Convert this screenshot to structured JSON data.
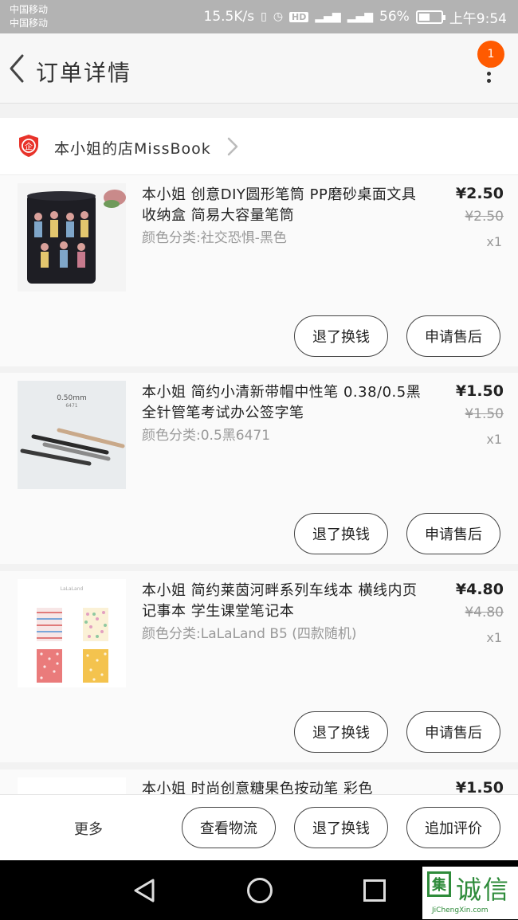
{
  "status_bar": {
    "carrier1": "中国移动",
    "carrier2": "中国移动",
    "speed": "15.5K/s",
    "hd": "HD",
    "battery": "56%",
    "battery_level": 0.56,
    "time": "上午9:54"
  },
  "header": {
    "title": "订单详情",
    "badge": "1"
  },
  "store": {
    "name": "本小姐的店MissBook",
    "badge_char": "企"
  },
  "items": [
    {
      "title": "本小姐 创意DIY圆形笔筒 PP磨砂桌面文具收纳盒 简易大容量笔筒",
      "variant": "颜色分类:社交恐惧-黑色",
      "price": "¥2.50",
      "orig_price": "¥2.50",
      "qty": "x1",
      "refund_label": "退了换钱",
      "aftersale_label": "申请售后"
    },
    {
      "title": "本小姐 简约小清新带帽中性笔 0.38/0.5黑全针管笔考试办公签字笔",
      "variant": "颜色分类:0.5黑6471",
      "price": "¥1.50",
      "orig_price": "¥1.50",
      "qty": "x1",
      "refund_label": "退了换钱",
      "aftersale_label": "申请售后",
      "thumb_text1": "0.50mm",
      "thumb_text2": "6471"
    },
    {
      "title": "本小姐 简约莱茵河畔系列车线本 横线内页记事本 学生课堂笔记本",
      "variant": "颜色分类:LaLaLand B5 (四款随机)",
      "price": "¥4.80",
      "orig_price": "¥4.80",
      "qty": "x1",
      "refund_label": "退了换钱",
      "aftersale_label": "申请售后",
      "thumb_text1": "LaLaLand"
    },
    {
      "title": "本小姐 时尚创意糖果色按动笔 彩色",
      "price": "¥1.50"
    }
  ],
  "bottom_bar": {
    "more": "更多",
    "logistics": "查看物流",
    "refund": "退了换钱",
    "review": "追加评价"
  },
  "watermark": {
    "mark": "集",
    "text": "诚信",
    "url": "JiChengXin.com"
  },
  "colors": {
    "accent_orange": "#ff5a00",
    "shield_red": "#e8332a",
    "watermark_green": "#2e8b3a"
  }
}
